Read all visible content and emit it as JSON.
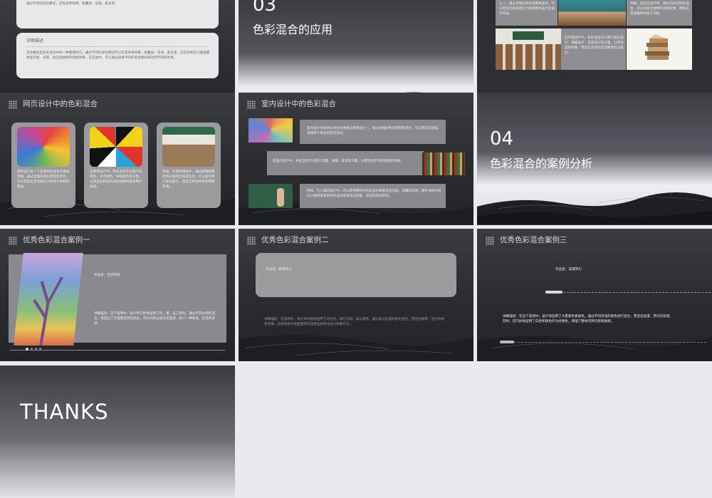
{
  "slide1": {
    "top_text": "通过不同的混合模式，实现多种效果，如叠加、穿透、柔光等。",
    "heading": "详细描述",
    "body": "混合模式是色彩混合中的一种重要技巧。通过不同的混合模式可以实现多种效果，如叠加、穿透、柔光等。这些效果可以使画面更加丰富、多变，创造出独特的视觉效果。在实践中，可以通过选择不同的混合模式来达到不同的效果。"
  },
  "slide2": {
    "number": "03",
    "title": "色彩混合的应用"
  },
  "slide3": {
    "left_top_text": "之一。通过合理的色彩搭配和混合，可以营造出具有吸引力和视觉冲击力的设计作品。",
    "right_top_text": "例如，在标志设计中，通过巧妙的色彩混合，可以创造出独特的视觉效果，使标志更加醒目和易于识别。",
    "mid_text": "在平面设计中，色彩混合可以用于标志设计、海报设计、包装设计等方面，以突出品牌形象、传达信息或引起消费者的注意力。"
  },
  "slide4": {
    "title": "网页设计中的色彩混合",
    "cards": [
      {
        "text": "网页设计是一个应用色彩混合的重要领域。通过合理的色彩搭配和混合，可以营造出具有吸引力和易于导航的网站。"
      },
      {
        "text": "在网页设计中，色彩混合可以用于背景色、文字颜色、按钮颜色等方面，以营造出和谐的视觉效果和提高用户体验。"
      },
      {
        "text": "例如，在电商网站中，通过使用鲜艳的色彩来突出商品信息，可以吸引用户的注意力，营造出更加愉悦的购物氛围。"
      }
    ]
  },
  "slide5": {
    "title": "室内设计中的色彩混合",
    "rows": [
      "室内设计也是色彩混合的重要应用领域之一。通过合理的色彩搭配和混合，可以营造出舒适、美观和个性化的室内空间。",
      "在室内设计中，色彩混合可以用于墙面、地面、家具等方面，以营造出不同的氛围和风格。",
      "例如，在儿童房设计中，可以使用明亮的色彩混合来营造出活泼、有趣的氛围；而在书房中则可以使用柔和的色彩混合来营造出安静、舒适的阅读环境。"
    ]
  },
  "slide6": {
    "number": "04",
    "title": "色彩混合的案例分析"
  },
  "slide7": {
    "title": "优秀色彩混合案例一",
    "label": "作品名：自然和谐",
    "desc": "详细描述：这个案例中，设计师巧妙地运用了红、黄、蓝三原色，通过不同比例的混合，营造出了丰富而自然的色彩。色彩间的过渡非常自然，给人一种和谐、舒适的感觉。"
  },
  "slide8": {
    "title": "优秀色彩混合案例二",
    "label": "作品名：鲜艳活力",
    "desc": "详细描述：在案例中，设计师大胆地运用了对比色，如红与绿、蓝与黄等，通过高对比度的色彩混合，营造出鲜艳、活力的视觉效果。这样的色彩搭配使得作品更加具有冲击力和吸引力。"
  },
  "slide9": {
    "title": "优秀色彩混合案例三",
    "label": "作品名：浪漫梦幻",
    "desc": "详细描述：在这个案例中，设计师运用了大量紫色系颜色，通过不同深浅的紫色进行混合，营造出浪漫、梦幻的氛围。同时，还巧妙地运用了白色和银色作为点缀色，增强了整体的梦幻感和质感。"
  },
  "slide10": {
    "title": "THANKS"
  },
  "colors": {
    "bg": "#2b2c30",
    "card": "#9b9b9e",
    "page": "#e9eaee"
  }
}
